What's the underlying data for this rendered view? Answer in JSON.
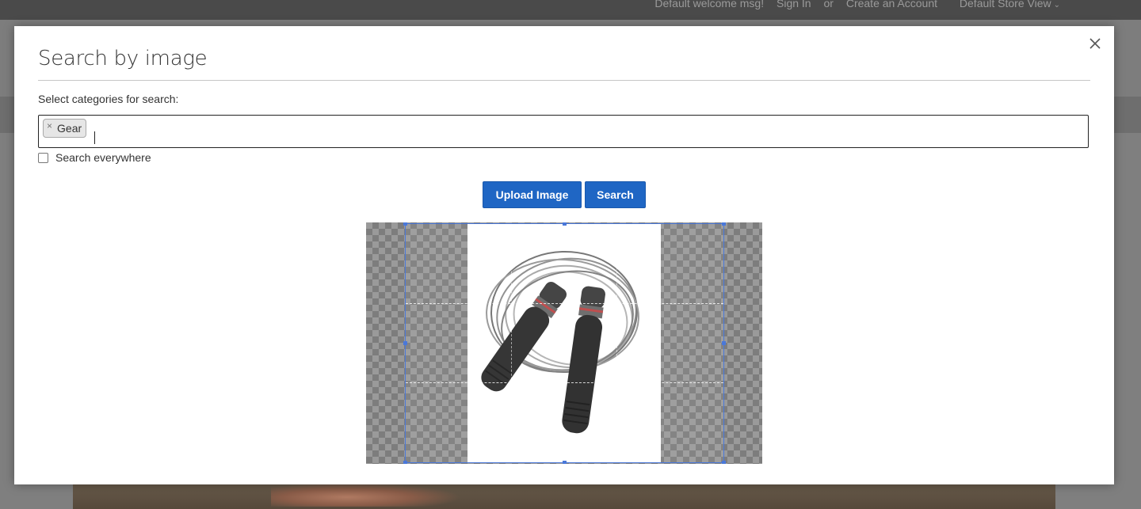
{
  "background_page": {
    "top_links": {
      "welcome": "Default welcome msg!",
      "sign_in": "Sign In",
      "or": "or",
      "create_account": "Create an Account",
      "store_view": "Default Store View"
    }
  },
  "modal": {
    "title": "Search by image",
    "close_icon": "close-icon",
    "categories_label": "Select categories for search:",
    "selected_categories": [
      {
        "label": "Gear",
        "remove_glyph": "×"
      }
    ],
    "search_everywhere": {
      "label": "Search everywhere",
      "checked": false
    },
    "buttons": {
      "upload": "Upload Image",
      "search": "Search"
    },
    "cropper": {
      "image_subject": "jump-rope-photo"
    }
  },
  "colors": {
    "primary_button": "#1f66c4",
    "crop_border": "#4a78d9"
  }
}
